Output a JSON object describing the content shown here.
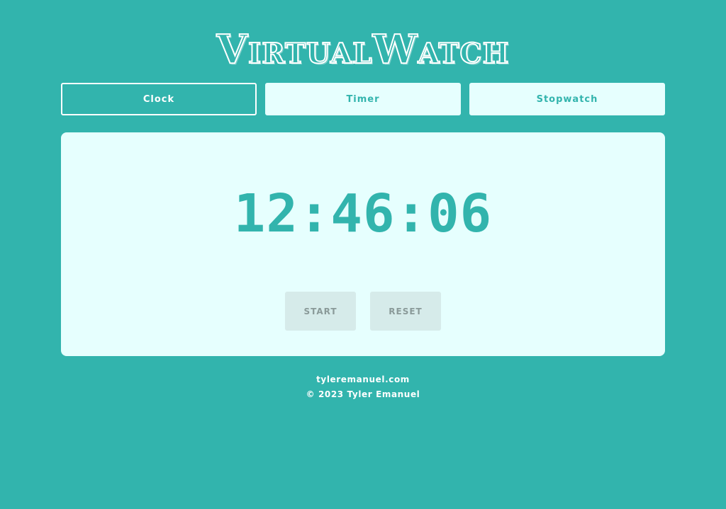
{
  "app": {
    "title": "VirtualWatch"
  },
  "tabs": [
    {
      "label": "Clock",
      "active": true
    },
    {
      "label": "Timer",
      "active": false
    },
    {
      "label": "Stopwatch",
      "active": false
    }
  ],
  "display": {
    "time": "12:46:06"
  },
  "controls": {
    "start_label": "START",
    "reset_label": "RESET",
    "disabled": true
  },
  "footer": {
    "link_text": "tyleremanuel.com",
    "copyright": "© 2023 Tyler Emanuel"
  },
  "colors": {
    "background": "#32b4ad",
    "panel": "#e6fffe",
    "accent": "#32b4ad",
    "button_disabled_bg": "#d6ebea",
    "button_disabled_text": "#8a9a99"
  }
}
